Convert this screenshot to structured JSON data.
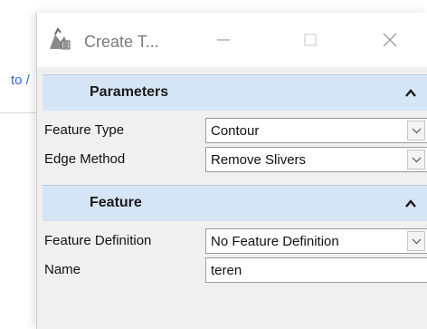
{
  "background_app": {
    "link_text": "to /"
  },
  "window": {
    "title": "Create T...",
    "app_icon": "create-terrain-icon",
    "controls": {
      "minimize": "minimize-icon",
      "maximize": "maximize-icon",
      "close": "close-icon"
    }
  },
  "sections": {
    "parameters": {
      "title": "Parameters",
      "rows": [
        {
          "label": "Feature Type",
          "value": "Contour"
        },
        {
          "label": "Edge Method",
          "value": "Remove Slivers"
        }
      ]
    },
    "feature": {
      "title": "Feature",
      "rows": [
        {
          "label": "Feature Definition",
          "value": "No Feature Definition"
        },
        {
          "label": "Name",
          "value": "teren"
        }
      ]
    }
  },
  "colors": {
    "section_header_bg": "#d6e5f5",
    "panel_bg": "#f0f0f0",
    "link": "#2a6bcc"
  }
}
